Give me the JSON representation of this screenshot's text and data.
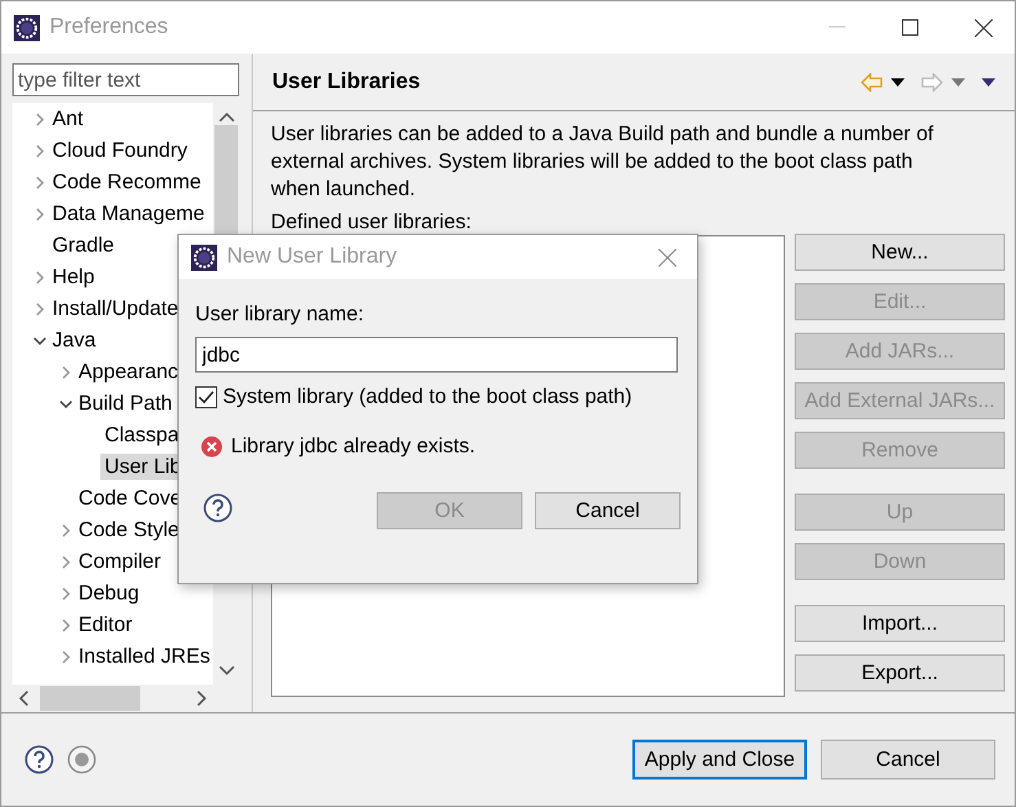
{
  "window": {
    "title": "Preferences"
  },
  "filter": {
    "placeholder": "type filter text"
  },
  "tree": [
    {
      "label": "Ant",
      "expanded": false,
      "selected": false
    },
    {
      "label": "Cloud Foundry",
      "expanded": false,
      "selected": false
    },
    {
      "label": "Code Recomme",
      "expanded": false,
      "selected": false
    },
    {
      "label": "Data Manageme",
      "expanded": false,
      "selected": false
    },
    {
      "label": "Gradle",
      "selected": false
    },
    {
      "label": "Help",
      "expanded": false,
      "selected": false
    },
    {
      "label": "Install/Update",
      "expanded": false,
      "selected": false
    },
    {
      "label": "Java",
      "expanded": true,
      "selected": false,
      "children": [
        {
          "label": "Appearanc",
          "expanded": false,
          "selected": false
        },
        {
          "label": "Build Path",
          "expanded": true,
          "selected": false,
          "children": [
            {
              "label": "Classpa",
              "selected": false
            },
            {
              "label": "User Lib",
              "selected": true
            }
          ]
        },
        {
          "label": "Code Cove",
          "selected": false
        },
        {
          "label": "Code Style",
          "expanded": false,
          "selected": false
        },
        {
          "label": "Compiler",
          "expanded": false,
          "selected": false
        },
        {
          "label": "Debug",
          "expanded": false,
          "selected": false
        },
        {
          "label": "Editor",
          "expanded": false,
          "selected": false
        },
        {
          "label": "Installed JREs",
          "expanded": false,
          "selected": false
        }
      ]
    }
  ],
  "page": {
    "title": "User Libraries",
    "description": "User libraries can be added to a Java Build path and bundle a number of external archives. System libraries will be added to the boot class path when launched.",
    "list_label": "Defined user libraries:",
    "button_groups": [
      [
        {
          "label": "New...",
          "disabled": false
        },
        {
          "label": "Edit...",
          "disabled": true
        },
        {
          "label": "Add JARs...",
          "disabled": true
        },
        {
          "label": "Add External JARs...",
          "disabled": true
        },
        {
          "label": "Remove",
          "disabled": true
        }
      ],
      [
        {
          "label": "Up",
          "disabled": true
        },
        {
          "label": "Down",
          "disabled": true
        }
      ],
      [
        {
          "label": "Import...",
          "disabled": false
        },
        {
          "label": "Export...",
          "disabled": false
        }
      ]
    ]
  },
  "footer": {
    "buttons": [
      {
        "label": "Apply and Close",
        "default": true
      },
      {
        "label": "Cancel",
        "default": false
      }
    ]
  },
  "dialog": {
    "title": "New User Library",
    "name_label": "User library name:",
    "name_value": "jdbc",
    "system_library": {
      "label": "System library (added to the boot class path)",
      "checked": true
    },
    "error": "Library jdbc already exists.",
    "buttons": [
      {
        "label": "OK",
        "disabled": true
      },
      {
        "label": "Cancel",
        "disabled": false
      }
    ]
  }
}
